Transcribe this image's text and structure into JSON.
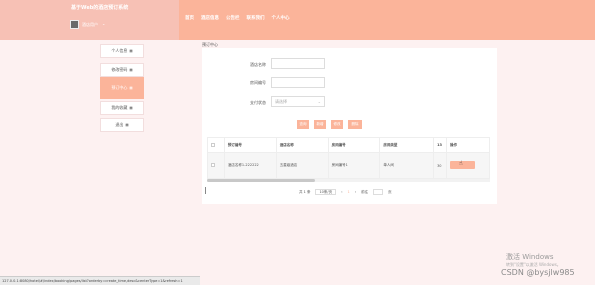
{
  "header": {
    "site_title": "基于Web的酒店预订系统",
    "user_name": "酒店用户",
    "caret": "⌄",
    "nav": [
      "首页",
      "酒店信息",
      "公告栏",
      "联系我们",
      "个人中心"
    ]
  },
  "sidebar": {
    "items": [
      {
        "label": "个人信息",
        "icon": "▦"
      },
      {
        "label": "修改密码",
        "icon": "▦"
      },
      {
        "label": "预订中心",
        "icon": "▦"
      },
      {
        "label": "我的收藏",
        "icon": "▦"
      },
      {
        "label": "退出",
        "icon": "▦"
      }
    ]
  },
  "breadcrumb": "预订中心",
  "form": {
    "field1_label": "酒店名称",
    "field2_label": "房间编号",
    "field3_label": "支付状态",
    "field3_placeholder": "请选择"
  },
  "buttons": [
    "查询",
    "新增",
    "修改",
    "删除"
  ],
  "table": {
    "headers": [
      "",
      "预订编号",
      "酒店名称",
      "房间编号",
      "房间类型",
      "13",
      "操作"
    ],
    "rows": [
      {
        "col1": "酒店名称1-222222",
        "col2": "五星级酒店",
        "col3": "房间编号1",
        "col4": "单人间",
        "col5": "30"
      }
    ]
  },
  "pagination": {
    "total": "共 1 条",
    "page_size": "10条/页",
    "prev": "‹",
    "page": "1",
    "next": "›",
    "goto_label": "前往",
    "page_suffix": "页"
  },
  "status_url": "127.0.0.1:8080/hotel/#/index/booking/pages/list?orderby=create_time,desc&centerType=1&refresh=1",
  "watermark": {
    "activate_title": "激活 Windows",
    "activate_sub": "转到\"设置\"以激活 Windows。",
    "csdn": "CSDN @bysjlw985"
  },
  "colors": {
    "accent": "#fbb49a",
    "brand_block": "#f7c1b5",
    "background": "#fdf1f1"
  }
}
